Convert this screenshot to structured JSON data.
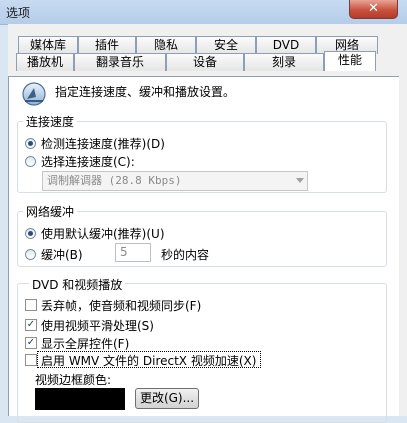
{
  "window": {
    "title": "选项",
    "close_glyph": "✕"
  },
  "tabs_row1": [
    "媒体库",
    "插件",
    "隐私",
    "安全",
    "DVD",
    "网络"
  ],
  "tabs_row2": [
    "播放机",
    "翻录音乐",
    "设备",
    "刻录",
    "性能"
  ],
  "active_tab": "性能",
  "header": {
    "description": "指定连接速度、缓冲和播放设置。",
    "icon": "performance-gauge-icon"
  },
  "connection": {
    "title": "连接速度",
    "detect": "检测连接速度(推荐)(D)",
    "choose": "选择连接速度(C):",
    "selected": "detect",
    "dropdown_value": "调制解调器 (28.8 Kbps)"
  },
  "buffering": {
    "title": "网络缓冲",
    "default_option": "使用默认缓冲(推荐)(U)",
    "custom_option": "缓冲(B)",
    "seconds_value": "5",
    "seconds_suffix": "秒的内容",
    "selected": "default"
  },
  "dvd_video": {
    "title": "DVD 和视频播放",
    "options": [
      {
        "label": "丢弃帧，使音频和视频同步(F)",
        "checked": false
      },
      {
        "label": "使用视频平滑处理(S)",
        "checked": true
      },
      {
        "label": "显示全屏控件(F)",
        "checked": true
      },
      {
        "label": "启用 WMV 文件的 DirectX 视频加速(X)",
        "checked": false
      }
    ],
    "border_color_label": "视频边框颜色:",
    "border_color": "#000000",
    "change_button": "更改(G)..."
  }
}
